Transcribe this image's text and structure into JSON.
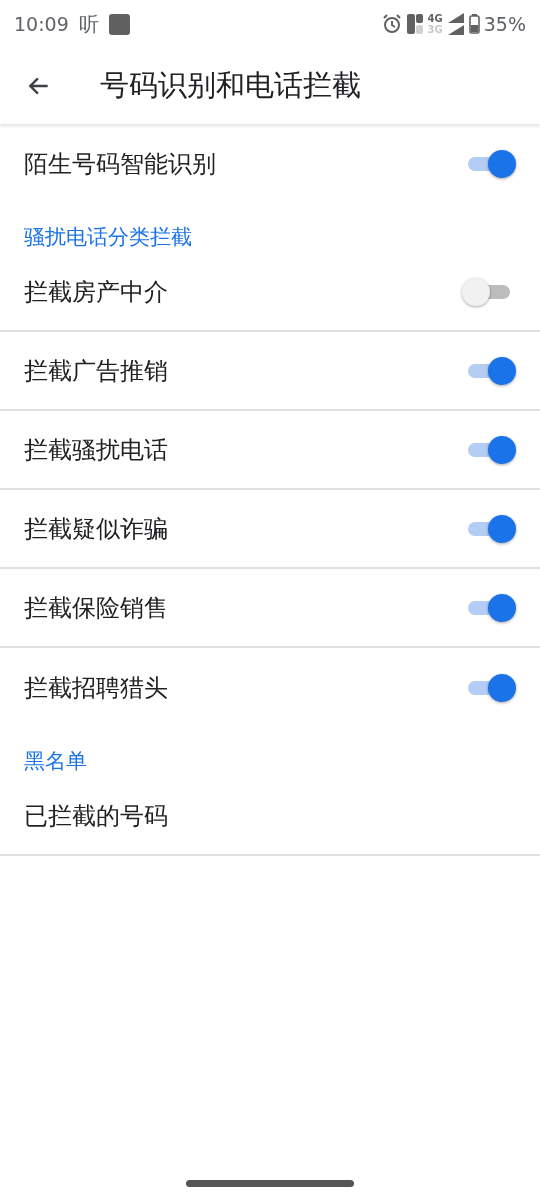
{
  "status_bar": {
    "time": "10:09",
    "app_glyph": "听",
    "network_top": "4G",
    "network_bottom": "3G",
    "battery": "35%"
  },
  "header": {
    "title": "号码识别和电话拦截"
  },
  "sections": [
    {
      "items": [
        {
          "kind": "toggle",
          "label": "陌生号码智能识别",
          "on": true,
          "divider": false
        }
      ]
    },
    {
      "header": "骚扰电话分类拦截",
      "items": [
        {
          "kind": "toggle",
          "label": "拦截房产中介",
          "on": false,
          "divider": true
        },
        {
          "kind": "toggle",
          "label": "拦截广告推销",
          "on": true,
          "divider": true
        },
        {
          "kind": "toggle",
          "label": "拦截骚扰电话",
          "on": true,
          "divider": true
        },
        {
          "kind": "toggle",
          "label": "拦截疑似诈骗",
          "on": true,
          "divider": true
        },
        {
          "kind": "toggle",
          "label": "拦截保险销售",
          "on": true,
          "divider": true
        },
        {
          "kind": "toggle",
          "label": "拦截招聘猎头",
          "on": true,
          "divider": false
        }
      ]
    },
    {
      "header": "黑名单",
      "items": [
        {
          "kind": "link",
          "label": "已拦截的号码",
          "divider": true
        }
      ]
    }
  ]
}
